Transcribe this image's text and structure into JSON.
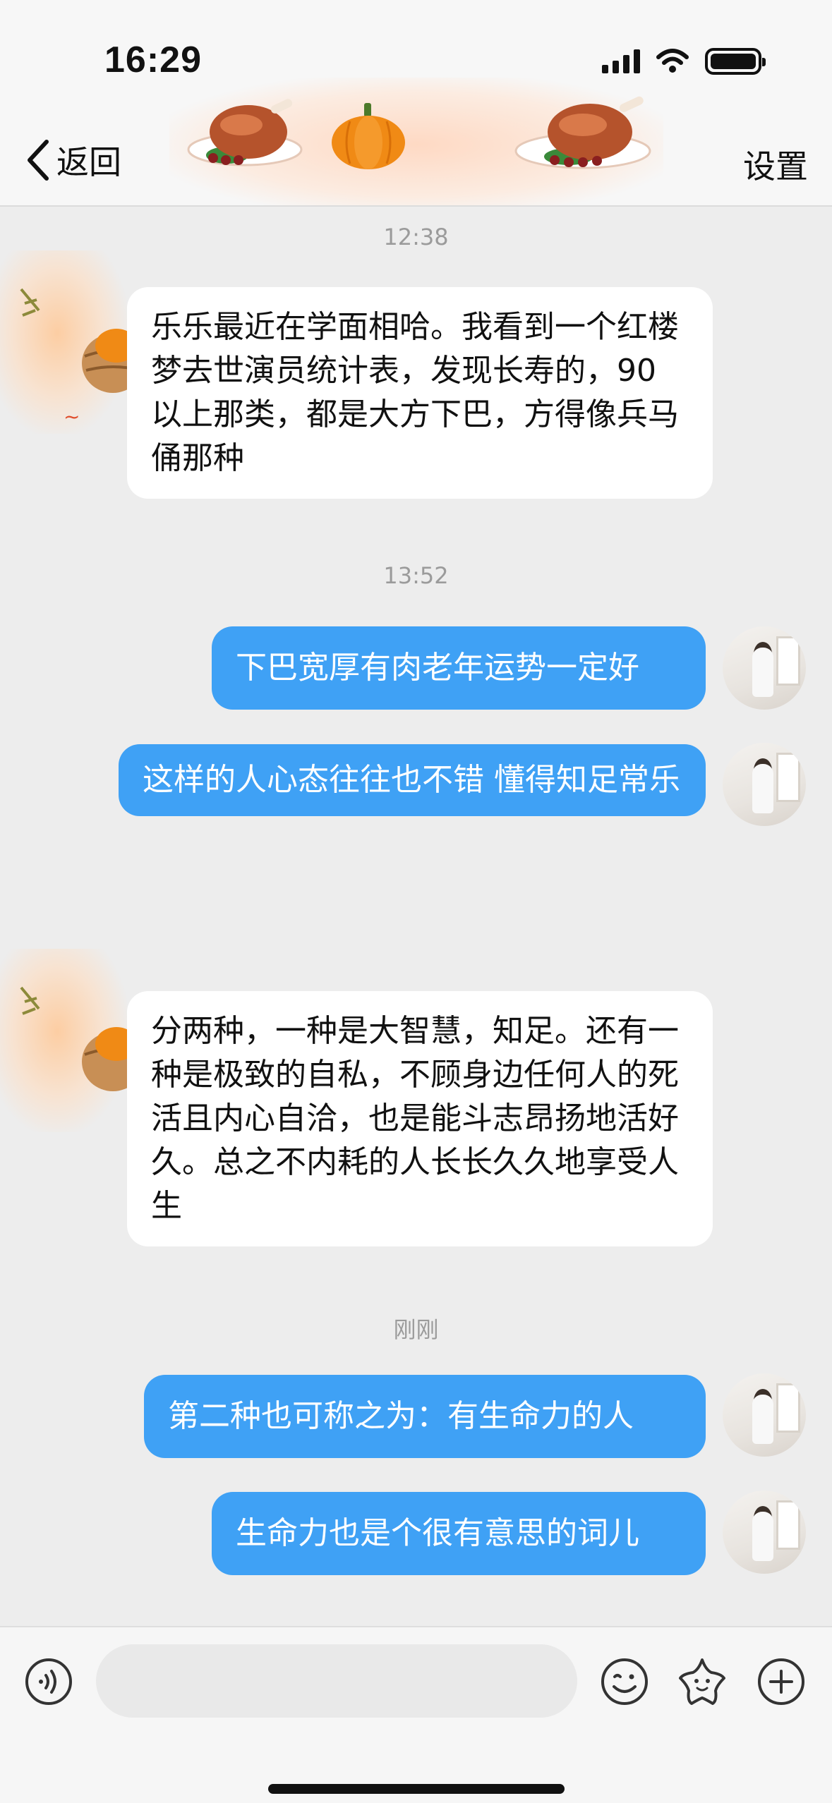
{
  "status_bar": {
    "time": "16:29"
  },
  "header": {
    "back_label": "返回",
    "settings_label": "设置"
  },
  "messages": [
    {
      "type": "timestamp",
      "text": "12:38"
    },
    {
      "type": "in",
      "text": "乐乐最近在学面相哈。我看到一个红楼梦去世演员统计表，发现长寿的，90 以上那类，都是大方下巴，方得像兵马俑那种"
    },
    {
      "type": "timestamp",
      "text": "13:52"
    },
    {
      "type": "out",
      "text": "下巴宽厚有肉老年运势一定好"
    },
    {
      "type": "out",
      "text": "这样的人心态往往也不错 懂得知足常乐"
    },
    {
      "type": "in",
      "text": "分两种，一种是大智慧，知足。还有一种是极致的自私，不顾身边任何人的死活且内心自洽，也是能斗志昂扬地活好久。总之不内耗的人长长久久地享受人生"
    },
    {
      "type": "timestamp",
      "text": "刚刚"
    },
    {
      "type": "out",
      "text": "第二种也可称之为：有生命力的人"
    },
    {
      "type": "out",
      "text": "生命力也是个很有意思的词儿"
    }
  ],
  "input": {
    "value": ""
  },
  "icons": {
    "voice": "voice-icon",
    "emoji": "emoji-icon",
    "sticker": "star-sticker-icon",
    "plus": "plus-icon"
  },
  "colors": {
    "outgoing_bubble": "#3fa1f5",
    "incoming_bubble": "#ffffff",
    "chat_background": "#ededed"
  }
}
